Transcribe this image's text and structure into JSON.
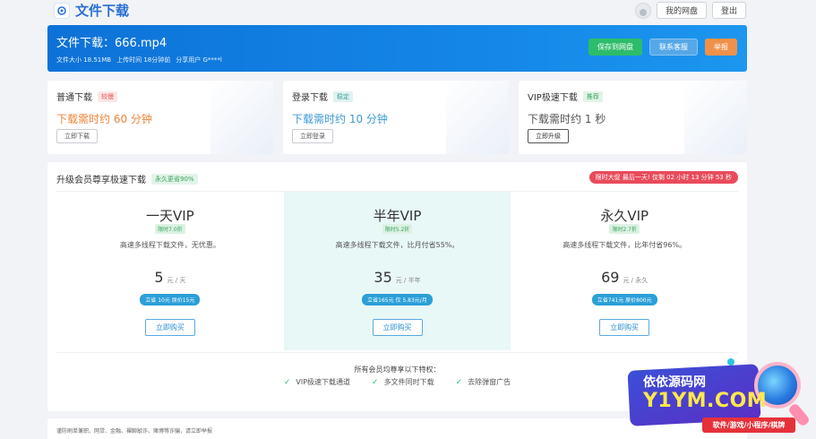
{
  "header": {
    "title": "文件下载",
    "my_disk_label": "我的网盘",
    "logout_label": "登出"
  },
  "hero": {
    "title": "文件下载：666.mp4",
    "file_size": "文件大小 18.51MB",
    "upload_time": "上传时间 18分钟前",
    "share_user": "分享用户 G****l",
    "save_label": "保存到网盘",
    "support_label": "联系客服",
    "report_label": "举报"
  },
  "download_options": [
    {
      "name": "普通下载",
      "tag": "较慢",
      "time": "下载需时约 60 分钟",
      "button": "立即下载"
    },
    {
      "name": "登录下载",
      "tag": "稳定",
      "time": "下载需时约 10 分钟",
      "button": "立即登录"
    },
    {
      "name": "VIP极速下载",
      "tag": "推荐",
      "time": "下载需时约 1 秒",
      "button": "立即升级"
    }
  ],
  "upgrade": {
    "title": "升级会员尊享极速下载",
    "badge": "永久更省90%",
    "countdown": "限时大促 最后一天! 仅剩 02 小时 13 分钟 53 秒",
    "plans": [
      {
        "name": "一天VIP",
        "discount": "限时7.0折",
        "desc": "高速多线程下载文件，无优惠。",
        "price": "5",
        "unit": "元 / 天",
        "save": "立省 10元 原价15元",
        "button": "立即购买"
      },
      {
        "name": "半年VIP",
        "discount": "限时5.2折",
        "desc": "高速多线程下载文件，比月付省55%。",
        "price": "35",
        "unit": "元 / 半年",
        "save": "立省165元 仅 5.83元/月",
        "button": "立即购买"
      },
      {
        "name": "永久VIP",
        "discount": "限时2.7折",
        "desc": "高速多线程下载文件，比年付省96%。",
        "price": "69",
        "unit": "元 / 永久",
        "save": "立省741元 原价800元",
        "button": "立即购买"
      }
    ],
    "perks_title": "所有会员均尊享以下特权：",
    "perks": [
      "VIP极速下载通道",
      "多文件同时下载",
      "去除弹窗广告"
    ]
  },
  "footer": {
    "text": "谨防刷单兼职、网贷、金融、裸聊敲诈、赌博等诈骗，请立即举报"
  },
  "watermark": {
    "cn": "依依源码网",
    "en": "Y1YM.COM",
    "tagline": "软件/游戏/小程序/棋牌"
  }
}
